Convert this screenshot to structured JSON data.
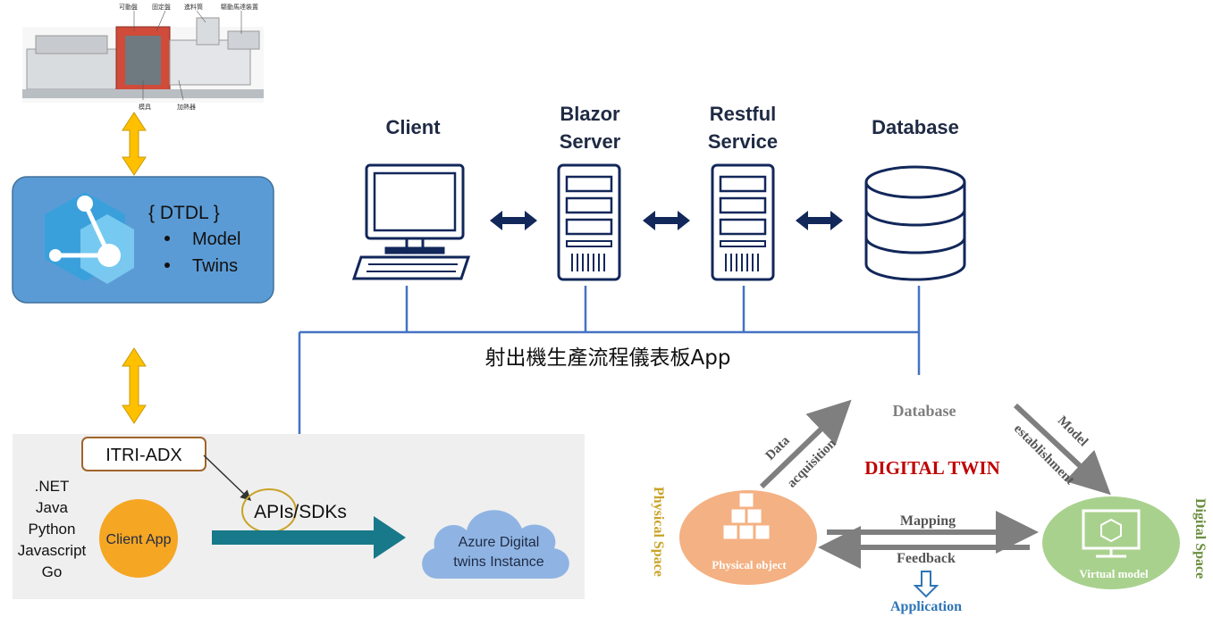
{
  "machine": {
    "labels_top": [
      "可動盤",
      "固定盤",
      "進料筒",
      "驅動馬達裝置"
    ],
    "labels_bottom": [
      "模具",
      "加熱器"
    ]
  },
  "dtdl": {
    "title": "{ DTDL }",
    "items": [
      "Model",
      "Twins"
    ]
  },
  "architecture": {
    "tiers": [
      {
        "line1": "Client",
        "line2": ""
      },
      {
        "line1": "Blazor",
        "line2": "Server"
      },
      {
        "line1": "Restful",
        "line2": "Service"
      },
      {
        "line1": "Database",
        "line2": ""
      }
    ],
    "app_title": "射出機生產流程儀表板App"
  },
  "sdk_panel": {
    "adx_label": "ITRI-ADX",
    "languages": [
      ".NET",
      "Java",
      "Python",
      "Javascript",
      "Go"
    ],
    "client_app": "Client App",
    "apis_label": "APIs/SDKs",
    "azure_line1": "Azure Digital",
    "azure_line2": "twins Instance"
  },
  "digital_twin": {
    "title": "DIGITAL TWIN",
    "database": "Database",
    "data_line1": "Data",
    "data_line2": "acquisition",
    "model_line1": "Model",
    "model_line2": "establishment",
    "mapping": "Mapping",
    "feedback": "Feedback",
    "application": "Application",
    "physical_space": "Physical Space",
    "digital_space": "Digital Space",
    "physical_object": "Physical object",
    "virtual_model": "Virtual model"
  },
  "colors": {
    "navy": "#12275a",
    "line_blue": "#4472c4",
    "gold": "#ffc000",
    "dtdl_box": "#5b9bd5",
    "title_red": "#c00000",
    "space_gold": "#c9a227",
    "space_green": "#6b8e3d",
    "physical_orange": "#f4b183",
    "virtual_green": "#a9d18e",
    "arrow_gray": "#7f7f7f",
    "app_blue": "#2e75b6",
    "cloud_blue": "#8fb4e3",
    "teal": "#17798a"
  }
}
